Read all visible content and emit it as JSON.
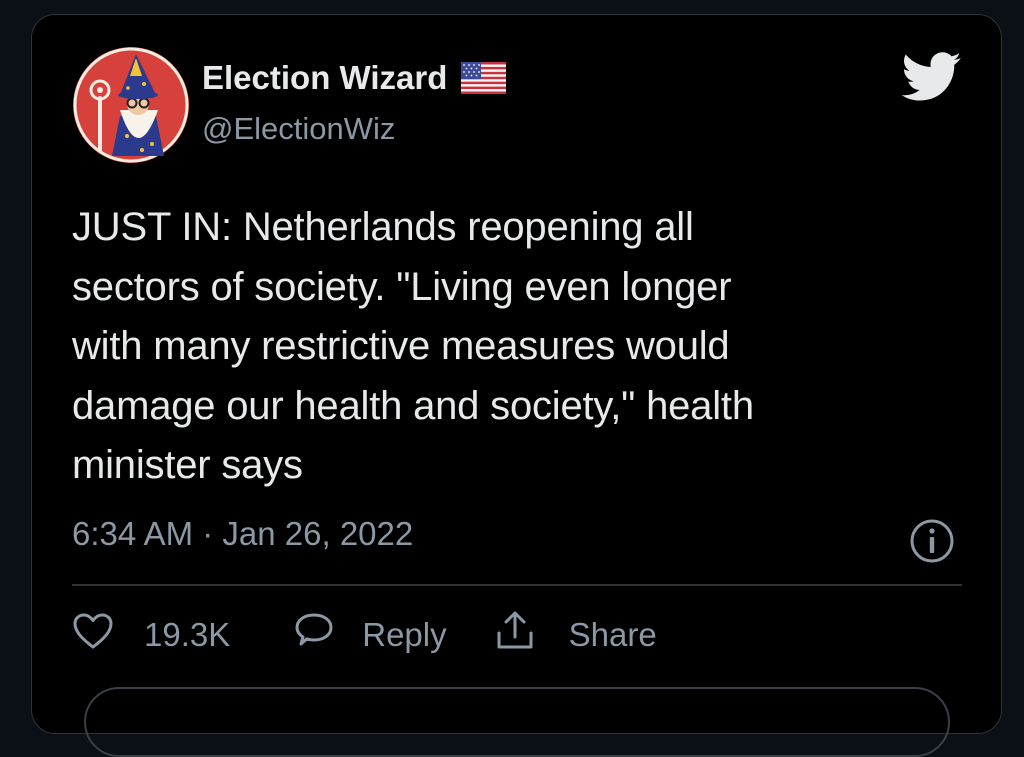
{
  "tweet": {
    "display_name": "Election Wizard",
    "handle": "@ElectionWiz",
    "text": "JUST IN: Netherlands reopening all\nsectors of society. \"Living even longer\nwith many restrictive measures would\ndamage our health and society,\" health\nminister says",
    "timestamp": "6:34 AM · Jan 26, 2022"
  },
  "actions": {
    "like_count": "19.3K",
    "reply_label": "Reply",
    "share_label": "Share"
  },
  "icons": {
    "avatar": "wizard-avatar",
    "flag": "us-flag-icon",
    "brand": "twitter-bird-icon",
    "info": "info-icon",
    "like": "heart-icon",
    "reply": "reply-bubble-icon",
    "share": "share-icon"
  },
  "colors": {
    "background": "#000000",
    "page_background": "#0a1015",
    "text_primary": "#e7e9ea",
    "text_secondary": "#8b98a5",
    "divider": "#2f3336",
    "avatar_red": "#d6413b"
  }
}
